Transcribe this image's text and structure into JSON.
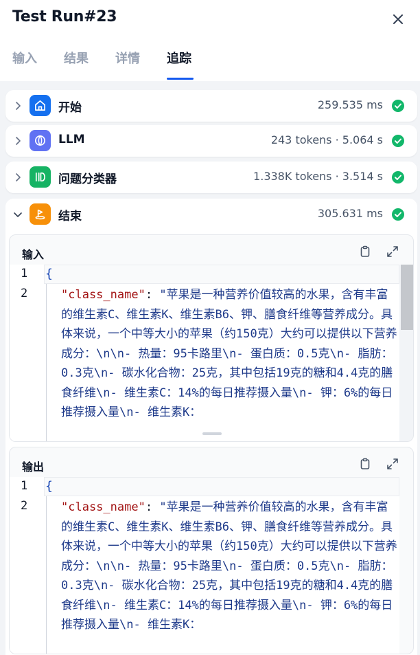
{
  "header": {
    "title": "Test Run#23"
  },
  "tabs": [
    {
      "label": "输入"
    },
    {
      "label": "结果"
    },
    {
      "label": "详情"
    },
    {
      "label": "追踪",
      "active": true
    }
  ],
  "nodes": [
    {
      "label": "开始",
      "meta": "259.535 ms",
      "icon": "home-icon",
      "color": "#1570ef",
      "status": "success"
    },
    {
      "label": "LLM",
      "meta": "243 tokens · 5.064 s",
      "icon": "llm-icon",
      "color": "#6172f3",
      "status": "success"
    },
    {
      "label": "问题分类器",
      "meta": "1.338K tokens · 3.514 s",
      "icon": "classifier-icon",
      "color": "#16b364",
      "status": "success"
    },
    {
      "label": "结束",
      "meta": "305.631 ms",
      "icon": "flag-icon",
      "color": "#f79009",
      "status": "success",
      "expanded": true
    }
  ],
  "panels": {
    "input": {
      "title": "输入",
      "line1": "1",
      "line2": "2",
      "brace": "{",
      "key": "\"class_name\"",
      "sep": ": ",
      "value": "\"苹果是一种营养价值较高的水果，含有丰富的维生素C、维生素K、维生素B6、钾、膳食纤维等营养成分。具体来说，一个中等大小的苹果（约150克）大约可以提供以下营养成分：\\n\\n- 热量：95卡路里\\n- 蛋白质：0.5克\\n- 脂肪：0.3克\\n- 碳水化合物：25克，其中包括19克的糖和4.4克的膳食纤维\\n- 维生素C：14%的每日推荐摄入量\\n- 钾：6%的每日推荐摄入量\\n- 维生素K："
    },
    "output": {
      "title": "输出",
      "line1": "1",
      "line2": "2",
      "brace": "{",
      "key": "\"class_name\"",
      "sep": ": ",
      "value": "\"苹果是一种营养价值较高的水果，含有丰富的维生素C、维生素K、维生素B6、钾、膳食纤维等营养成分。具体来说，一个中等大小的苹果（约150克）大约可以提供以下营养成分：\\n\\n- 热量：95卡路里\\n- 蛋白质：0.5克\\n- 脂肪：0.3克\\n- 碳水化合物：25克，其中包括19克的糖和4.4克的膳食纤维\\n- 维生素C：14%的每日推荐摄入量\\n- 钾：6%的每日推荐摄入量\\n- 维生素K："
    }
  },
  "colors": {
    "accent": "#155aef",
    "success": "#12b76a",
    "json_key": "#a31515",
    "json_string": "#1e3a8a"
  }
}
